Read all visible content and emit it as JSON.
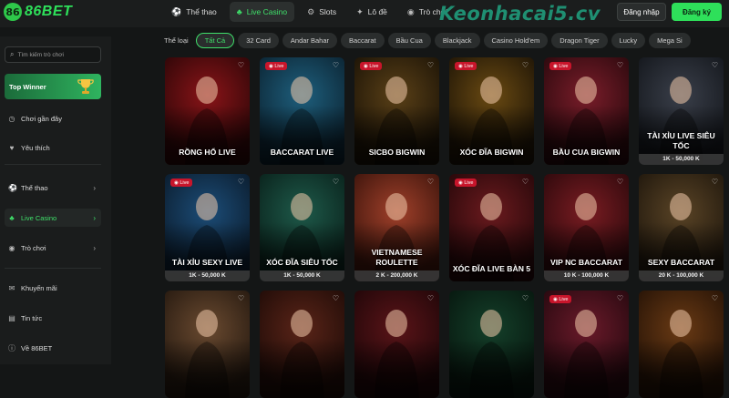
{
  "brand": {
    "logo_mark": "86",
    "logo_text": "86BET"
  },
  "topnav": [
    {
      "label": "Thể thao",
      "icon": "soccer-icon",
      "glyph": "⚽",
      "active": false
    },
    {
      "label": "Live Casino",
      "icon": "cards-icon",
      "glyph": "♣",
      "active": true
    },
    {
      "label": "Slots",
      "icon": "slot-icon",
      "glyph": "⚙",
      "active": false
    },
    {
      "label": "Lô đề",
      "icon": "lottery-icon",
      "glyph": "✦",
      "active": false
    },
    {
      "label": "Trò chơi",
      "icon": "gamepad-icon",
      "glyph": "◉",
      "active": false
    }
  ],
  "watermark": "Keonhacai5.cv",
  "auth": {
    "login_label": "Đăng nhập",
    "register_label": "Đăng ký"
  },
  "sidebar": {
    "search_placeholder": "Tìm kiếm trò chơi",
    "top_winner_label": "Top Winner",
    "items": [
      {
        "label": "Chơi gần đây",
        "icon": "clock-icon",
        "glyph": "◷",
        "chevron": false,
        "active": false
      },
      {
        "label": "Yêu thích",
        "icon": "heart-icon",
        "glyph": "♥",
        "chevron": false,
        "active": false
      },
      {
        "label": "Thể thao",
        "icon": "soccer-icon",
        "glyph": "⚽",
        "chevron": true,
        "active": false
      },
      {
        "label": "Live Casino",
        "icon": "cards-icon",
        "glyph": "♣",
        "chevron": true,
        "active": true
      },
      {
        "label": "Trò chơi",
        "icon": "gamepad-icon",
        "glyph": "◉",
        "chevron": true,
        "active": false
      },
      {
        "label": "Khuyến mãi",
        "icon": "gift-icon",
        "glyph": "✉",
        "chevron": false,
        "active": false
      },
      {
        "label": "Tin tức",
        "icon": "news-icon",
        "glyph": "▤",
        "chevron": false,
        "active": false
      },
      {
        "label": "Về 86BET",
        "icon": "info-icon",
        "glyph": "ⓘ",
        "chevron": false,
        "active": false
      }
    ]
  },
  "filters": {
    "label": "Thể loại",
    "chips": [
      "Tất Cả",
      "32 Card",
      "Andar Bahar",
      "Baccarat",
      "Bầu Cua",
      "Blackjack",
      "Casino Hold'em",
      "Dragon Tiger",
      "Lucky",
      "Mega Si"
    ],
    "active_index": 0
  },
  "colors": {
    "accent": "#3fe06a",
    "live_badge": "#c8152b",
    "background": "#141616"
  },
  "games": [
    {
      "title": "Rồng Hổ Live",
      "range": "",
      "live": false,
      "colors": [
        "#8a1418",
        "#2b0607"
      ]
    },
    {
      "title": "Baccarat Live",
      "range": "",
      "live": true,
      "colors": [
        "#1e5f7d",
        "#0b2230"
      ]
    },
    {
      "title": "Sicbo BigWin",
      "range": "",
      "live": true,
      "colors": [
        "#5a4017",
        "#1a1206"
      ]
    },
    {
      "title": "Xóc Đĩa BigWin",
      "range": "",
      "live": true,
      "colors": [
        "#6a4a12",
        "#1c1306"
      ]
    },
    {
      "title": "Bầu Cua BigWin",
      "range": "",
      "live": true,
      "colors": [
        "#7a1d2a",
        "#28080c"
      ]
    },
    {
      "title": "Tài Xỉu Live Siêu Tốc",
      "range": "1K - 50,000 K",
      "live": false,
      "colors": [
        "#3a3f4a",
        "#13161b"
      ]
    },
    {
      "title": "Tài Xỉu Sexy Live",
      "range": "1K - 50,000 K",
      "live": true,
      "colors": [
        "#1c4d78",
        "#0a1a2a"
      ]
    },
    {
      "title": "Xóc Đĩa Siêu Tốc",
      "range": "1K - 50,000 K",
      "live": false,
      "colors": [
        "#1e5a4a",
        "#09201a"
      ]
    },
    {
      "title": "Vietnamese Roulette",
      "range": "2 K - 200,000 K",
      "live": false,
      "colors": [
        "#a0402a",
        "#3a130b"
      ]
    },
    {
      "title": "Xóc Đĩa Live Bàn 5",
      "range": "",
      "live": true,
      "colors": [
        "#6b1a1e",
        "#240709"
      ]
    },
    {
      "title": "VIP NC Baccarat",
      "range": "10 K - 100,000 K",
      "live": false,
      "colors": [
        "#7a1c22",
        "#2a080b"
      ]
    },
    {
      "title": "Sexy Baccarat",
      "range": "20 K - 100,000 K",
      "live": false,
      "colors": [
        "#5a4426",
        "#1e160c"
      ]
    },
    {
      "title": "",
      "range": "",
      "live": false,
      "colors": [
        "#6a4a30",
        "#24180f"
      ]
    },
    {
      "title": "",
      "range": "",
      "live": false,
      "colors": [
        "#5a2418",
        "#1e0b07"
      ]
    },
    {
      "title": "",
      "range": "",
      "live": false,
      "colors": [
        "#5a1418",
        "#1e0608"
      ]
    },
    {
      "title": "",
      "range": "",
      "live": false,
      "colors": [
        "#14402a",
        "#07160e"
      ]
    },
    {
      "title": "",
      "range": "",
      "live": true,
      "colors": [
        "#6a1a2a",
        "#24080e"
      ]
    },
    {
      "title": "",
      "range": "",
      "live": false,
      "colors": [
        "#6a3a14",
        "#241206"
      ]
    }
  ],
  "live_badge_label": "Live",
  "live_badge_upper": "LIVE"
}
